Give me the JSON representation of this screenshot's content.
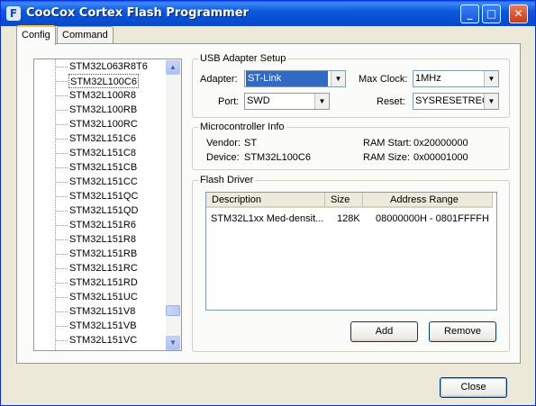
{
  "window": {
    "title": "CooCox Cortex Flash Programmer",
    "icon_letter": "F"
  },
  "title_buttons": {
    "minimize": "_",
    "maximize": "□",
    "close": "✕"
  },
  "tabs": [
    {
      "label": "Config"
    },
    {
      "label": "Command"
    }
  ],
  "device_list": {
    "items": [
      "STM32L063R8T6",
      "STM32L100C6",
      "STM32L100R8",
      "STM32L100RB",
      "STM32L100RC",
      "STM32L151C6",
      "STM32L151C8",
      "STM32L151CB",
      "STM32L151CC",
      "STM32L151QC",
      "STM32L151QD",
      "STM32L151R6",
      "STM32L151R8",
      "STM32L151RB",
      "STM32L151RC",
      "STM32L151RD",
      "STM32L151UC",
      "STM32L151V8",
      "STM32L151VB",
      "STM32L151VC"
    ],
    "selected": "STM32L100C6"
  },
  "usb_adapter": {
    "title": "USB Adapter Setup",
    "adapter_label": "Adapter:",
    "adapter_value": "ST-Link",
    "port_label": "Port:",
    "port_value": "SWD",
    "max_clock_label": "Max Clock:",
    "max_clock_value": "1MHz",
    "reset_label": "Reset:",
    "reset_value": "SYSRESETREQ"
  },
  "mcu_info": {
    "title": "Microcontroller Info",
    "vendor_label": "Vendor:",
    "vendor_value": "ST",
    "device_label": "Device:",
    "device_value": "STM32L100C6",
    "ram_start_label": "RAM Start:",
    "ram_start_value": "0x20000000",
    "ram_size_label": "RAM Size:",
    "ram_size_value": "0x00001000"
  },
  "flash_driver": {
    "title": "Flash Driver",
    "columns": [
      "Description",
      "Size",
      "Address Range"
    ],
    "rows": [
      {
        "description": "STM32L1xx Med-densit...",
        "size": "128K",
        "address_range": "08000000H - 0801FFFFH"
      }
    ],
    "add_label": "Add",
    "remove_label": "Remove"
  },
  "footer": {
    "close_label": "Close"
  },
  "icons": {
    "scroll_up": "▲",
    "scroll_down": "▼",
    "dropdown": "▼"
  }
}
